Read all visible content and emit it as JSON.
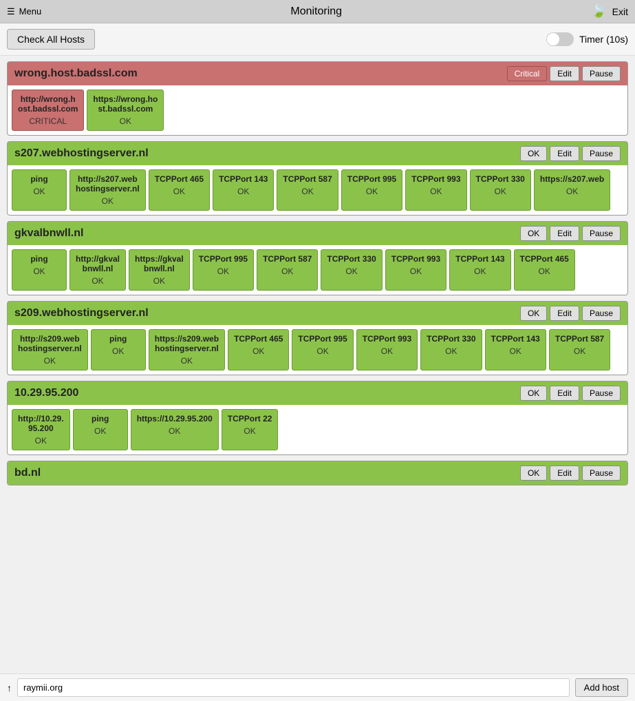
{
  "topbar": {
    "menu_label": "Menu",
    "title": "Monitoring",
    "exit_label": "Exit"
  },
  "toolbar": {
    "check_all_label": "Check All Hosts",
    "timer_label": "Timer (10s)"
  },
  "hosts": [
    {
      "id": "wrong-host-badssl",
      "name": "wrong.host.badssl.com",
      "status": "critical",
      "actions": [
        "Critical",
        "Edit",
        "Pause"
      ],
      "services": [
        {
          "name": "http://wrong.h\nost.badssl.com",
          "status": "CRITICAL",
          "status_class": "critical"
        },
        {
          "name": "https://wrong.ho\nst.badssl.com",
          "status": "OK",
          "status_class": "ok"
        }
      ]
    },
    {
      "id": "s207-webhostingserver",
      "name": "s207.webhostingserver.nl",
      "status": "ok",
      "actions": [
        "OK",
        "Edit",
        "Pause"
      ],
      "services": [
        {
          "name": "ping",
          "status": "OK",
          "status_class": "ok"
        },
        {
          "name": "http://s207.web\nhostingserver.nl",
          "status": "OK",
          "status_class": "ok"
        },
        {
          "name": "TCPPort 465",
          "status": "OK",
          "status_class": "ok"
        },
        {
          "name": "TCPPort 143",
          "status": "OK",
          "status_class": "ok"
        },
        {
          "name": "TCPPort 587",
          "status": "OK",
          "status_class": "ok"
        },
        {
          "name": "TCPPort 995",
          "status": "OK",
          "status_class": "ok"
        },
        {
          "name": "TCPPort 993",
          "status": "OK",
          "status_class": "ok"
        },
        {
          "name": "TCPPort 330",
          "status": "OK",
          "status_class": "ok"
        },
        {
          "name": "https://s207.web",
          "status": "OK",
          "status_class": "ok"
        }
      ]
    },
    {
      "id": "gkvalbnwll",
      "name": "gkvalbnwll.nl",
      "status": "ok",
      "actions": [
        "OK",
        "Edit",
        "Pause"
      ],
      "services": [
        {
          "name": "ping",
          "status": "OK",
          "status_class": "ok"
        },
        {
          "name": "http://gkval\nbnwll.nl",
          "status": "OK",
          "status_class": "ok"
        },
        {
          "name": "https://gkval\nbnwll.nl",
          "status": "OK",
          "status_class": "ok"
        },
        {
          "name": "TCPPort 995",
          "status": "OK",
          "status_class": "ok"
        },
        {
          "name": "TCPPort 587",
          "status": "OK",
          "status_class": "ok"
        },
        {
          "name": "TCPPort 330",
          "status": "OK",
          "status_class": "ok"
        },
        {
          "name": "TCPPort 993",
          "status": "OK",
          "status_class": "ok"
        },
        {
          "name": "TCPPort 143",
          "status": "OK",
          "status_class": "ok"
        },
        {
          "name": "TCPPort 465",
          "status": "OK",
          "status_class": "ok"
        }
      ]
    },
    {
      "id": "s209-webhostingserver",
      "name": "s209.webhostingserver.nl",
      "status": "ok",
      "actions": [
        "OK",
        "Edit",
        "Pause"
      ],
      "services": [
        {
          "name": "http://s209.web\nhostingserver.nl",
          "status": "OK",
          "status_class": "ok"
        },
        {
          "name": "ping",
          "status": "OK",
          "status_class": "ok"
        },
        {
          "name": "https://s209.web\nhostingserver.nl",
          "status": "OK",
          "status_class": "ok"
        },
        {
          "name": "TCPPort 465",
          "status": "OK",
          "status_class": "ok"
        },
        {
          "name": "TCPPort 995",
          "status": "OK",
          "status_class": "ok"
        },
        {
          "name": "TCPPort 993",
          "status": "OK",
          "status_class": "ok"
        },
        {
          "name": "TCPPort 330",
          "status": "OK",
          "status_class": "ok"
        },
        {
          "name": "TCPPort 143",
          "status": "OK",
          "status_class": "ok"
        },
        {
          "name": "TCPPort 587",
          "status": "OK",
          "status_class": "ok"
        }
      ]
    },
    {
      "id": "10-29-95-200",
      "name": "10.29.95.200",
      "status": "ok",
      "actions": [
        "OK",
        "Edit",
        "Pause"
      ],
      "services": [
        {
          "name": "http://10.29.\n95.200",
          "status": "OK",
          "status_class": "ok"
        },
        {
          "name": "ping",
          "status": "OK",
          "status_class": "ok"
        },
        {
          "name": "https://10.29.95.200",
          "status": "OK",
          "status_class": "ok"
        },
        {
          "name": "TCPPort 22",
          "status": "OK",
          "status_class": "ok"
        }
      ]
    },
    {
      "id": "bd-nl",
      "name": "bd.nl",
      "status": "ok",
      "actions": [
        "OK",
        "Edit",
        "Pause"
      ],
      "services": []
    }
  ],
  "bottom": {
    "arrow_label": "↑",
    "input_value": "raymii.org",
    "input_placeholder": "raymii.org",
    "add_host_label": "Add host"
  }
}
